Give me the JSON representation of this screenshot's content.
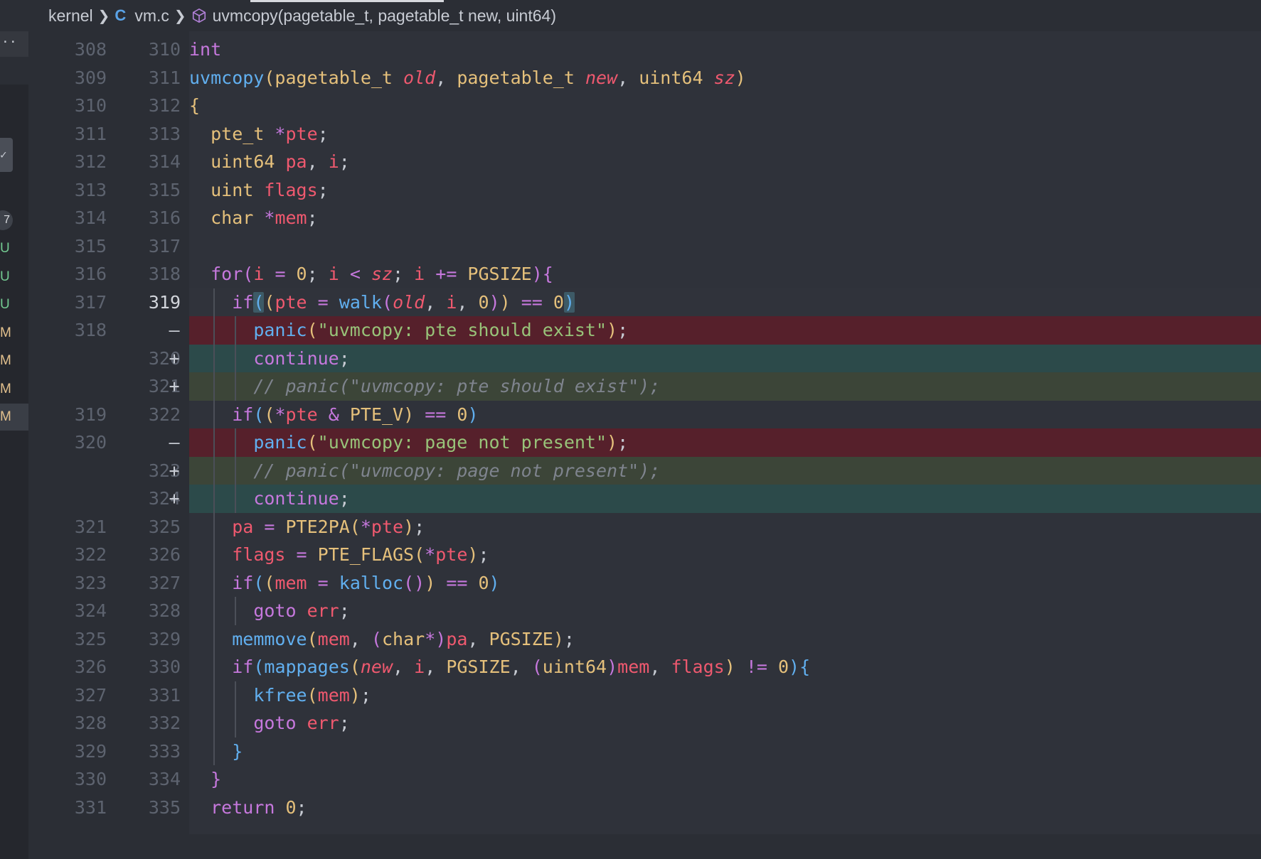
{
  "breadcrumb": {
    "folder": "kernel",
    "file_icon": "C",
    "file": "vm.c",
    "symbol": "uvmcopy(pagetable_t, pagetable_t new, uint64)"
  },
  "sidebar": {
    "top_label": "..",
    "check_label": "✓",
    "count": "7",
    "badges": [
      "U",
      "U",
      "U",
      "M",
      "M",
      "M",
      "M"
    ]
  },
  "diff": [
    {
      "old": "308",
      "new": "310",
      "mark": "",
      "kind": "normal",
      "tokens": [
        {
          "t": "int",
          "c": "kw"
        }
      ]
    },
    {
      "old": "309",
      "new": "311",
      "mark": "",
      "kind": "normal",
      "tokens": [
        {
          "t": "uvmcopy",
          "c": "fn"
        },
        {
          "t": "(",
          "c": "p1"
        },
        {
          "t": "pagetable_t ",
          "c": "type"
        },
        {
          "t": "old",
          "c": "param"
        },
        {
          "t": ", ",
          "c": "punc"
        },
        {
          "t": "pagetable_t ",
          "c": "type"
        },
        {
          "t": "new",
          "c": "param"
        },
        {
          "t": ", ",
          "c": "punc"
        },
        {
          "t": "uint64 ",
          "c": "type"
        },
        {
          "t": "sz",
          "c": "param"
        },
        {
          "t": ")",
          "c": "p1"
        }
      ]
    },
    {
      "old": "310",
      "new": "312",
      "mark": "",
      "kind": "normal",
      "tokens": [
        {
          "t": "{",
          "c": "p1"
        }
      ]
    },
    {
      "old": "311",
      "new": "313",
      "mark": "",
      "kind": "normal",
      "indent": 1,
      "tokens": [
        {
          "t": "pte_t ",
          "c": "type"
        },
        {
          "t": "*",
          "c": "op"
        },
        {
          "t": "pte",
          "c": "var"
        },
        {
          "t": ";",
          "c": "punc"
        }
      ]
    },
    {
      "old": "312",
      "new": "314",
      "mark": "",
      "kind": "normal",
      "indent": 1,
      "tokens": [
        {
          "t": "uint64 ",
          "c": "type"
        },
        {
          "t": "pa",
          "c": "var"
        },
        {
          "t": ", ",
          "c": "punc"
        },
        {
          "t": "i",
          "c": "var"
        },
        {
          "t": ";",
          "c": "punc"
        }
      ]
    },
    {
      "old": "313",
      "new": "315",
      "mark": "",
      "kind": "normal",
      "indent": 1,
      "tokens": [
        {
          "t": "uint ",
          "c": "type"
        },
        {
          "t": "flags",
          "c": "var"
        },
        {
          "t": ";",
          "c": "punc"
        }
      ]
    },
    {
      "old": "314",
      "new": "316",
      "mark": "",
      "kind": "normal",
      "indent": 1,
      "tokens": [
        {
          "t": "char ",
          "c": "type"
        },
        {
          "t": "*",
          "c": "op"
        },
        {
          "t": "mem",
          "c": "var"
        },
        {
          "t": ";",
          "c": "punc"
        }
      ]
    },
    {
      "old": "315",
      "new": "317",
      "mark": "",
      "kind": "normal",
      "tokens": []
    },
    {
      "old": "316",
      "new": "318",
      "mark": "",
      "kind": "normal",
      "indent": 1,
      "tokens": [
        {
          "t": "for",
          "c": "kw"
        },
        {
          "t": "(",
          "c": "p2"
        },
        {
          "t": "i ",
          "c": "var"
        },
        {
          "t": "= ",
          "c": "op"
        },
        {
          "t": "0",
          "c": "num"
        },
        {
          "t": "; ",
          "c": "punc"
        },
        {
          "t": "i ",
          "c": "var"
        },
        {
          "t": "< ",
          "c": "op"
        },
        {
          "t": "sz",
          "c": "param"
        },
        {
          "t": "; ",
          "c": "punc"
        },
        {
          "t": "i ",
          "c": "var"
        },
        {
          "t": "+= ",
          "c": "op"
        },
        {
          "t": "PGSIZE",
          "c": "macro"
        },
        {
          "t": ")",
          "c": "p2"
        },
        {
          "t": "{",
          "c": "p2"
        }
      ]
    },
    {
      "old": "317",
      "new": "319",
      "mark": "",
      "kind": "cursor",
      "active": true,
      "indent": 2,
      "tokens": [
        {
          "t": "if",
          "c": "kw"
        },
        {
          "t": "(",
          "c": "p3",
          "box": true
        },
        {
          "t": "(",
          "c": "p1"
        },
        {
          "t": "pte ",
          "c": "var"
        },
        {
          "t": "= ",
          "c": "op"
        },
        {
          "t": "walk",
          "c": "fn"
        },
        {
          "t": "(",
          "c": "p2"
        },
        {
          "t": "old",
          "c": "param"
        },
        {
          "t": ", ",
          "c": "punc"
        },
        {
          "t": "i",
          "c": "var"
        },
        {
          "t": ", ",
          "c": "punc"
        },
        {
          "t": "0",
          "c": "num"
        },
        {
          "t": ")",
          "c": "p2"
        },
        {
          "t": ")",
          "c": "p1"
        },
        {
          "t": " == ",
          "c": "op"
        },
        {
          "t": "0",
          "c": "num"
        },
        {
          "t": ")",
          "c": "p3",
          "box": true
        }
      ]
    },
    {
      "old": "318",
      "new": "",
      "mark": "—",
      "kind": "removed",
      "indent": 3,
      "tokens": [
        {
          "t": "panic",
          "c": "fn"
        },
        {
          "t": "(",
          "c": "p1"
        },
        {
          "t": "\"uvmcopy: pte should exist\"",
          "c": "str"
        },
        {
          "t": ")",
          "c": "p1"
        },
        {
          "t": ";",
          "c": "punc"
        }
      ]
    },
    {
      "old": "",
      "new": "320",
      "mark": "+",
      "kind": "added",
      "indent": 3,
      "tokens": [
        {
          "t": "continue",
          "c": "kw"
        },
        {
          "t": ";",
          "c": "punc"
        }
      ]
    },
    {
      "old": "",
      "new": "321",
      "mark": "+",
      "kind": "added-mod",
      "indent": 3,
      "tokens": [
        {
          "t": "// panic(\"uvmcopy: pte should exist\");",
          "c": "cmt"
        }
      ]
    },
    {
      "old": "319",
      "new": "322",
      "mark": "",
      "kind": "normal",
      "indent": 2,
      "tokens": [
        {
          "t": "if",
          "c": "kw"
        },
        {
          "t": "(",
          "c": "p3"
        },
        {
          "t": "(",
          "c": "p1"
        },
        {
          "t": "*",
          "c": "op"
        },
        {
          "t": "pte ",
          "c": "var"
        },
        {
          "t": "& ",
          "c": "op"
        },
        {
          "t": "PTE_V",
          "c": "macro"
        },
        {
          "t": ")",
          "c": "p1"
        },
        {
          "t": " == ",
          "c": "op"
        },
        {
          "t": "0",
          "c": "num"
        },
        {
          "t": ")",
          "c": "p3"
        }
      ]
    },
    {
      "old": "320",
      "new": "",
      "mark": "—",
      "kind": "removed",
      "indent": 3,
      "tokens": [
        {
          "t": "panic",
          "c": "fn"
        },
        {
          "t": "(",
          "c": "p1"
        },
        {
          "t": "\"uvmcopy: page not present\"",
          "c": "str"
        },
        {
          "t": ")",
          "c": "p1"
        },
        {
          "t": ";",
          "c": "punc"
        }
      ]
    },
    {
      "old": "",
      "new": "323",
      "mark": "+",
      "kind": "added-mod",
      "indent": 3,
      "tokens": [
        {
          "t": "// panic(\"uvmcopy: page not present\");",
          "c": "cmt"
        }
      ]
    },
    {
      "old": "",
      "new": "324",
      "mark": "+",
      "kind": "added",
      "indent": 3,
      "tokens": [
        {
          "t": "continue",
          "c": "kw"
        },
        {
          "t": ";",
          "c": "punc"
        }
      ]
    },
    {
      "old": "321",
      "new": "325",
      "mark": "",
      "kind": "normal",
      "indent": 2,
      "tokens": [
        {
          "t": "pa ",
          "c": "var"
        },
        {
          "t": "= ",
          "c": "op"
        },
        {
          "t": "PTE2PA",
          "c": "macro"
        },
        {
          "t": "(",
          "c": "p1"
        },
        {
          "t": "*",
          "c": "op"
        },
        {
          "t": "pte",
          "c": "var"
        },
        {
          "t": ")",
          "c": "p1"
        },
        {
          "t": ";",
          "c": "punc"
        }
      ]
    },
    {
      "old": "322",
      "new": "326",
      "mark": "",
      "kind": "normal",
      "indent": 2,
      "tokens": [
        {
          "t": "flags ",
          "c": "var"
        },
        {
          "t": "= ",
          "c": "op"
        },
        {
          "t": "PTE_FLAGS",
          "c": "macro"
        },
        {
          "t": "(",
          "c": "p1"
        },
        {
          "t": "*",
          "c": "op"
        },
        {
          "t": "pte",
          "c": "var"
        },
        {
          "t": ")",
          "c": "p1"
        },
        {
          "t": ";",
          "c": "punc"
        }
      ]
    },
    {
      "old": "323",
      "new": "327",
      "mark": "",
      "kind": "normal",
      "indent": 2,
      "tokens": [
        {
          "t": "if",
          "c": "kw"
        },
        {
          "t": "(",
          "c": "p3"
        },
        {
          "t": "(",
          "c": "p1"
        },
        {
          "t": "mem ",
          "c": "var"
        },
        {
          "t": "= ",
          "c": "op"
        },
        {
          "t": "kalloc",
          "c": "fn"
        },
        {
          "t": "()",
          "c": "p2"
        },
        {
          "t": ")",
          "c": "p1"
        },
        {
          "t": " == ",
          "c": "op"
        },
        {
          "t": "0",
          "c": "num"
        },
        {
          "t": ")",
          "c": "p3"
        }
      ]
    },
    {
      "old": "324",
      "new": "328",
      "mark": "",
      "kind": "normal",
      "indent": 3,
      "tokens": [
        {
          "t": "goto ",
          "c": "kw"
        },
        {
          "t": "err",
          "c": "var"
        },
        {
          "t": ";",
          "c": "punc"
        }
      ]
    },
    {
      "old": "325",
      "new": "329",
      "mark": "",
      "kind": "normal",
      "indent": 2,
      "tokens": [
        {
          "t": "memmove",
          "c": "fn"
        },
        {
          "t": "(",
          "c": "p1"
        },
        {
          "t": "mem",
          "c": "var"
        },
        {
          "t": ", ",
          "c": "punc"
        },
        {
          "t": "(",
          "c": "p2"
        },
        {
          "t": "char",
          "c": "type"
        },
        {
          "t": "*",
          "c": "op"
        },
        {
          "t": ")",
          "c": "p2"
        },
        {
          "t": "pa",
          "c": "var"
        },
        {
          "t": ", ",
          "c": "punc"
        },
        {
          "t": "PGSIZE",
          "c": "macro"
        },
        {
          "t": ")",
          "c": "p1"
        },
        {
          "t": ";",
          "c": "punc"
        }
      ]
    },
    {
      "old": "326",
      "new": "330",
      "mark": "",
      "kind": "normal",
      "indent": 2,
      "tokens": [
        {
          "t": "if",
          "c": "kw"
        },
        {
          "t": "(",
          "c": "p3"
        },
        {
          "t": "mappages",
          "c": "fn"
        },
        {
          "t": "(",
          "c": "p1"
        },
        {
          "t": "new",
          "c": "param"
        },
        {
          "t": ", ",
          "c": "punc"
        },
        {
          "t": "i",
          "c": "var"
        },
        {
          "t": ", ",
          "c": "punc"
        },
        {
          "t": "PGSIZE",
          "c": "macro"
        },
        {
          "t": ", ",
          "c": "punc"
        },
        {
          "t": "(",
          "c": "p2"
        },
        {
          "t": "uint64",
          "c": "type"
        },
        {
          "t": ")",
          "c": "p2"
        },
        {
          "t": "mem",
          "c": "var"
        },
        {
          "t": ", ",
          "c": "punc"
        },
        {
          "t": "flags",
          "c": "var"
        },
        {
          "t": ")",
          "c": "p1"
        },
        {
          "t": " != ",
          "c": "op"
        },
        {
          "t": "0",
          "c": "num"
        },
        {
          "t": ")",
          "c": "p3"
        },
        {
          "t": "{",
          "c": "p3"
        }
      ]
    },
    {
      "old": "327",
      "new": "331",
      "mark": "",
      "kind": "normal",
      "indent": 3,
      "tokens": [
        {
          "t": "kfree",
          "c": "fn"
        },
        {
          "t": "(",
          "c": "p1"
        },
        {
          "t": "mem",
          "c": "var"
        },
        {
          "t": ")",
          "c": "p1"
        },
        {
          "t": ";",
          "c": "punc"
        }
      ]
    },
    {
      "old": "328",
      "new": "332",
      "mark": "",
      "kind": "normal",
      "indent": 3,
      "tokens": [
        {
          "t": "goto ",
          "c": "kw"
        },
        {
          "t": "err",
          "c": "var"
        },
        {
          "t": ";",
          "c": "punc"
        }
      ]
    },
    {
      "old": "329",
      "new": "333",
      "mark": "",
      "kind": "normal",
      "indent": 2,
      "tokens": [
        {
          "t": "}",
          "c": "p3"
        }
      ]
    },
    {
      "old": "330",
      "new": "334",
      "mark": "",
      "kind": "normal",
      "indent": 1,
      "tokens": [
        {
          "t": "}",
          "c": "p2"
        }
      ]
    },
    {
      "old": "331",
      "new": "335",
      "mark": "",
      "kind": "normal",
      "indent": 1,
      "tokens": [
        {
          "t": "return ",
          "c": "kw"
        },
        {
          "t": "0",
          "c": "num"
        },
        {
          "t": ";",
          "c": "punc"
        }
      ]
    }
  ]
}
